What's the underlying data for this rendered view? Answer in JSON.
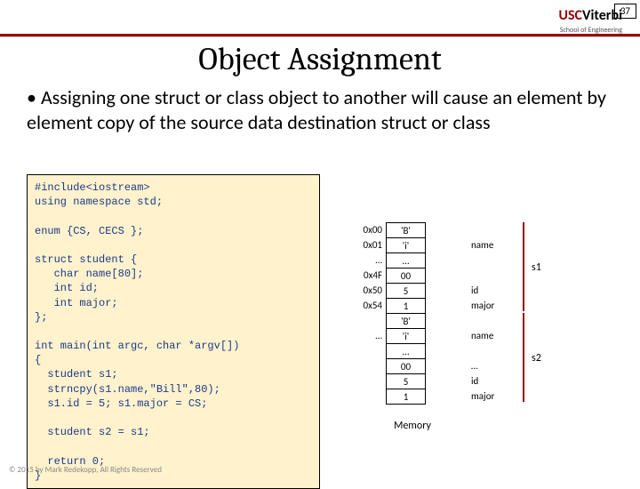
{
  "page_number": "37",
  "logo": {
    "usc": "USC",
    "viterbi": "Viterbi",
    "sub": "School of Engineering"
  },
  "title": "Object Assignment",
  "bullet": "Assigning one struct or class object to another will cause an element by element copy of the source data destination struct or class",
  "code": "#include<iostream>\nusing namespace std;\n\nenum {CS, CECS };\n\nstruct student {\n   char name[80];\n   int id;\n   int major;\n};\n\nint main(int argc, char *argv[])\n{\n  student s1;\n  strncpy(s1.name,\"Bill\",80);\n  s1.id = 5; s1.major = CS;\n\n  student s2 = s1;\n\n  return 0;\n}",
  "addrs": [
    "0x00",
    "0x01",
    "…",
    "0x4F",
    "0x50",
    "0x54",
    "",
    "…",
    "",
    "",
    "",
    ""
  ],
  "cells": [
    "'B'",
    "'i'",
    "…",
    "00",
    "5",
    "1",
    "'B'",
    "'i'",
    "…",
    "00",
    "5",
    "1"
  ],
  "labels": [
    "",
    "name",
    "",
    "",
    "id",
    "major",
    "",
    "name",
    "",
    "…",
    "id",
    "major"
  ],
  "s1": "s1",
  "s2": "s2",
  "memory_label": "Memory",
  "footer": "© 2015 by Mark Redekopp, All Rights Reserved"
}
